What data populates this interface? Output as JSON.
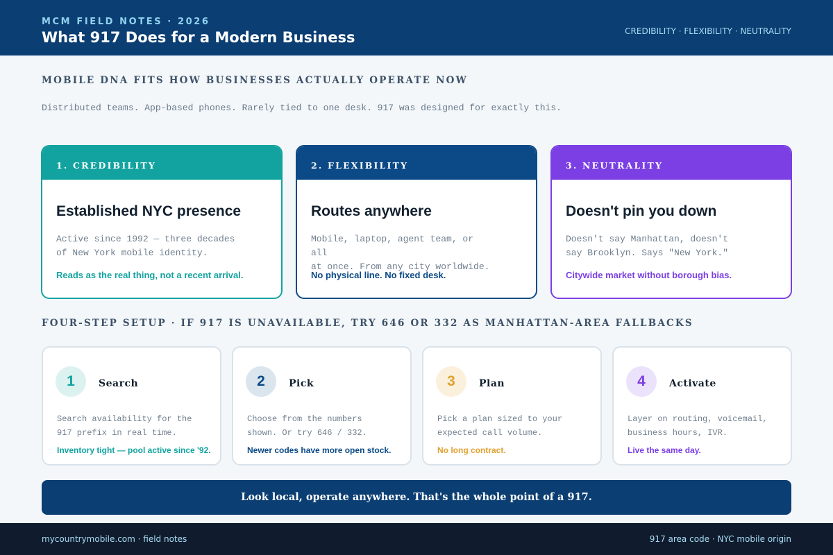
{
  "header": {
    "kicker": "MCM FIELD NOTES · 2026",
    "title": "What 917 Does for a Modern Business",
    "tagline": "CREDIBILITY · FLEXIBILITY · NEUTRALITY"
  },
  "section1": {
    "heading": "Mobile DNA fits how businesses actually operate now",
    "intro": "Distributed teams. App-based phones. Rarely tied to one desk. 917 was designed for exactly this."
  },
  "pillars": [
    {
      "label": "1. CREDIBILITY",
      "title": "Established NYC presence",
      "body_line1": "Active since 1992 — three decades",
      "body_line2": "of New York mobile identity.",
      "note": "Reads as the real thing, not a recent arrival.",
      "color": "#12a3a0"
    },
    {
      "label": "2. FLEXIBILITY",
      "title": "Routes anywhere",
      "body_line1": "Mobile, laptop, agent team, or all",
      "body_line2": "at once. From any city worldwide.",
      "note": "No physical line. No fixed desk.",
      "color": "#0b4a86"
    },
    {
      "label": "3. NEUTRALITY",
      "title": "Doesn't pin you down",
      "body_line1": "Doesn't say Manhattan, doesn't",
      "body_line2": "say Brooklyn. Says \"New York.\"",
      "note": "Citywide market without borough bias.",
      "color": "#7b3fe4"
    }
  ],
  "section2": {
    "heading": "Four-step setup · If 917 is unavailable, try 646 or 332 as Manhattan-area fallbacks"
  },
  "steps": [
    {
      "number": "1",
      "title": "Search",
      "body_line1": "Search availability for the",
      "body_line2": "917 prefix in real time.",
      "note": "Inventory tight — pool active since '92.",
      "color": "#12a3a0",
      "badge_bg": "#dcf2f1"
    },
    {
      "number": "2",
      "title": "Pick",
      "body_line1": "Choose from the numbers",
      "body_line2": "shown. Or try 646 / 332.",
      "note": "Newer codes have more open stock.",
      "color": "#0b4a86",
      "badge_bg": "#dbe5ee"
    },
    {
      "number": "3",
      "title": "Plan",
      "body_line1": "Pick a plan sized to your",
      "body_line2": "expected call volume.",
      "note": "No long contract.",
      "color": "#e0a12e",
      "badge_bg": "#fbf0dc"
    },
    {
      "number": "4",
      "title": "Activate",
      "body_line1": "Layer on routing, voicemail,",
      "body_line2": "business hours, IVR.",
      "note": "Live the same day.",
      "color": "#7b3fe4",
      "badge_bg": "#ebe2fb"
    }
  ],
  "banner": {
    "text": "Look local, operate anywhere. That's the whole point of a 917."
  },
  "footer": {
    "left": "mycountrymobile.com · field notes",
    "right": "917 area code · NYC mobile origin"
  }
}
